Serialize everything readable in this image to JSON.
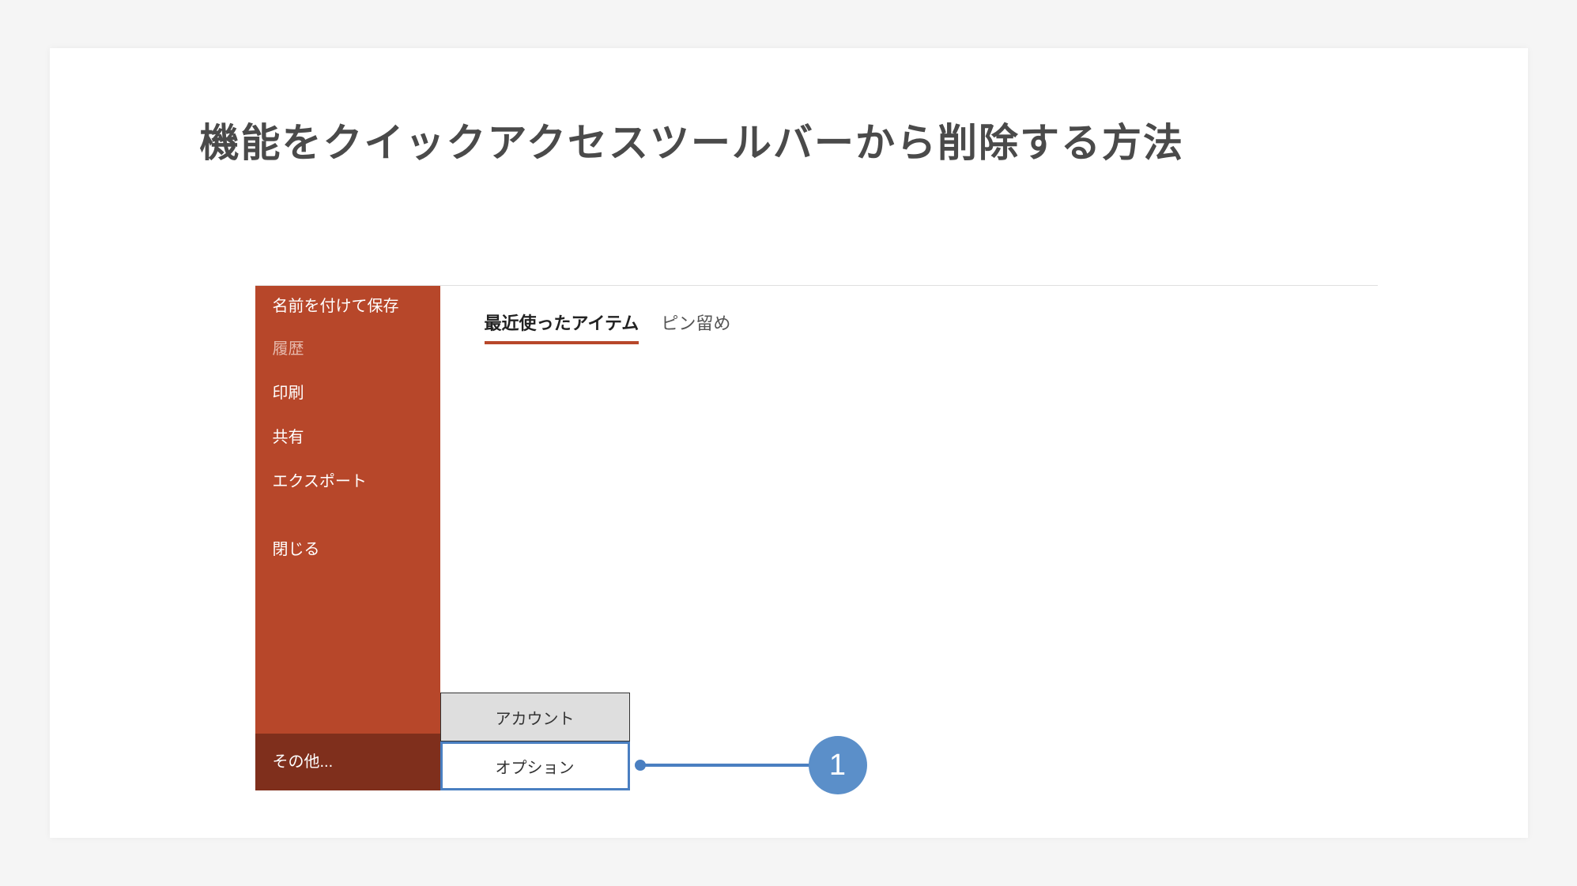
{
  "title": "機能をクイックアクセスツールバーから削除する方法",
  "sidebar": {
    "save_as": "名前を付けて保存",
    "history": "履歴",
    "print": "印刷",
    "share": "共有",
    "export": "エクスポート",
    "close": "閉じる",
    "others": "その他..."
  },
  "submenu": {
    "account": "アカウント",
    "options": "オプション"
  },
  "tabs": {
    "recent": "最近使ったアイテム",
    "pinned": "ピン留め"
  },
  "callout": {
    "number": "1"
  }
}
